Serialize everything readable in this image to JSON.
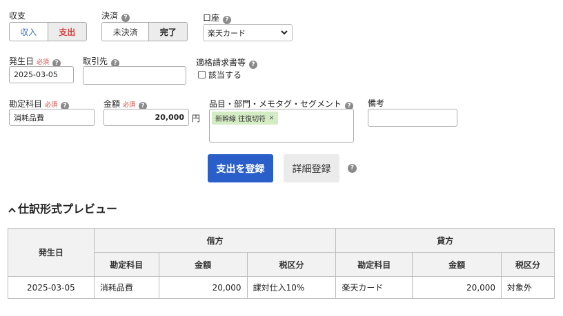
{
  "income_expense": {
    "label": "収支",
    "income": "収入",
    "expense": "支出",
    "selected": "支出"
  },
  "settlement": {
    "label": "決済",
    "unsettled": "未決済",
    "done": "完了",
    "selected": "完了"
  },
  "account": {
    "label": "口座",
    "value": "楽天カード"
  },
  "date": {
    "label": "発生日",
    "required": "必須",
    "value": "2025-03-05"
  },
  "partner": {
    "label": "取引先",
    "value": ""
  },
  "qualified_invoice": {
    "label": "適格請求書等",
    "checkbox_label": "該当する"
  },
  "subject": {
    "label": "勘定科目",
    "required": "必須",
    "value": "消耗品費"
  },
  "amount": {
    "label": "金額",
    "required": "必須",
    "value": "20,000",
    "unit": "円"
  },
  "tags": {
    "label": "品目・部門・メモタグ・セグメント",
    "items": [
      "新幹線 往復切符"
    ],
    "remove": "×"
  },
  "remarks": {
    "label": "備考",
    "value": ""
  },
  "actions": {
    "register": "支出を登録",
    "detail": "詳細登録"
  },
  "preview": {
    "title": "仕訳形式プレビュー"
  },
  "table": {
    "date_header": "発生日",
    "debit": "借方",
    "credit": "貸方",
    "sub_headers": [
      "勘定科目",
      "金額",
      "税区分",
      "勘定科目",
      "金額",
      "税区分"
    ],
    "row": {
      "date": "2025-03-05",
      "debit_subject": "消耗品費",
      "debit_amount": "20,000",
      "debit_tax": "課対仕入10%",
      "credit_subject": "楽天カード",
      "credit_amount": "20,000",
      "credit_tax": "対象外"
    }
  },
  "colors": {
    "primary": "#2a5fc9",
    "expense": "#d9403a",
    "tag_bg": "#d4ecc4",
    "header_bg": "#f2f2f2"
  }
}
